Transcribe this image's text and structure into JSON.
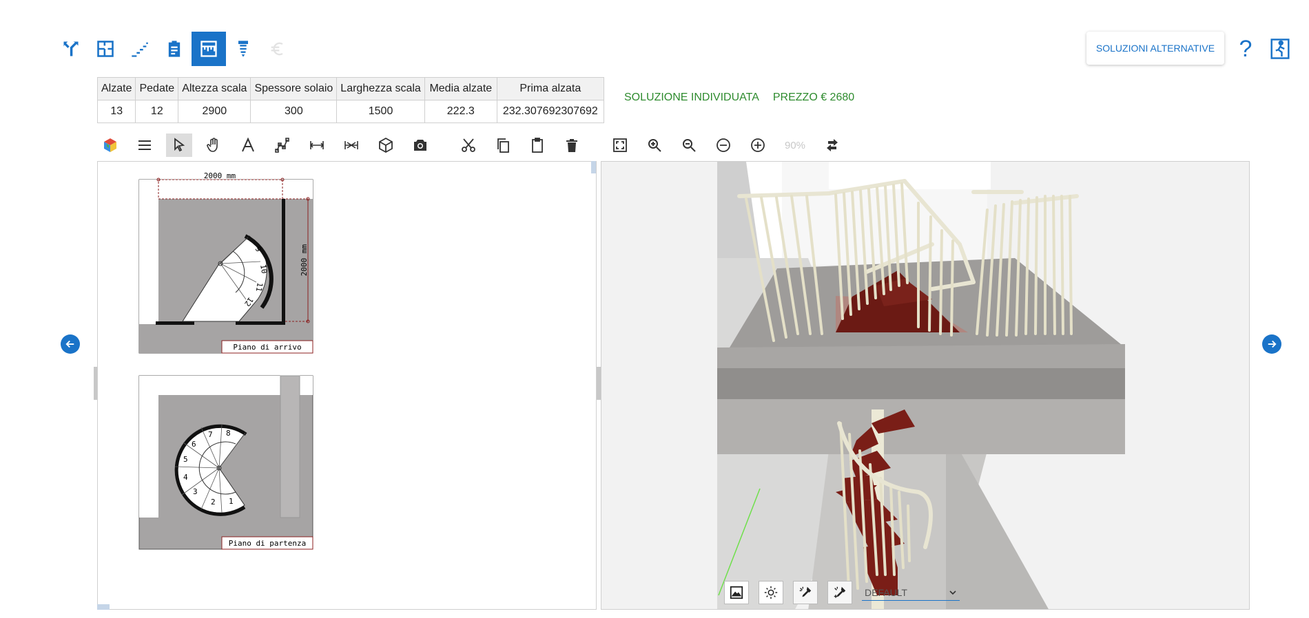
{
  "nav": {
    "items": [
      {
        "icon": "stair-type-icon"
      },
      {
        "icon": "floor-plan-icon"
      },
      {
        "icon": "stairs-icon"
      },
      {
        "icon": "clipboard-icon"
      },
      {
        "icon": "ruler-icon",
        "active": true
      },
      {
        "icon": "screw-icon"
      },
      {
        "icon": "euro-icon",
        "disabled": true
      }
    ],
    "alt_solutions_label": "SOLUZIONI ALTERNATIVE",
    "help_label": "?",
    "exit_icon": "exit-icon"
  },
  "summary": {
    "headers": [
      "Alzate",
      "Pedate",
      "Altezza scala",
      "Spessore solaio",
      "Larghezza scala",
      "Media alzate",
      "Prima alzata"
    ],
    "values": [
      "13",
      "12",
      "2900",
      "300",
      "1500",
      "222.3",
      "232.307692307692"
    ]
  },
  "status": {
    "solution": "SOLUZIONE INDIVIDUATA",
    "price": "PREZZO € 2680"
  },
  "toolbar": {
    "zoom": "90%"
  },
  "plan": {
    "dim_top": "2000 mm",
    "dim_side": "2000 mm",
    "upper_label": "Piano di arrivo",
    "lower_label": "Piano di partenza",
    "upper_steps": [
      "9",
      "10",
      "11",
      "12"
    ],
    "lower_steps": [
      "1",
      "2",
      "3",
      "4",
      "5",
      "6",
      "7",
      "8"
    ]
  },
  "view": {
    "render_mode": "DEFAULT"
  }
}
